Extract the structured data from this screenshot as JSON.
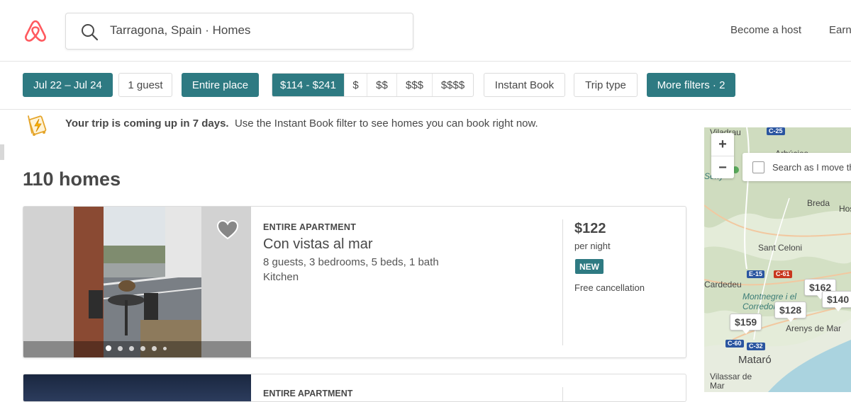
{
  "header": {
    "search_value": "Tarragona, Spain · Homes",
    "nav": {
      "become_host": "Become a host",
      "earn": "Earn"
    }
  },
  "filters": {
    "dates": "Jul 22 – Jul 24",
    "guests": "1 guest",
    "room_type": "Entire place",
    "price_range": "$114 - $241",
    "price_levels": [
      "$",
      "$$",
      "$$$",
      "$$$$"
    ],
    "instant_book": "Instant Book",
    "trip_type": "Trip type",
    "more_filters": "More filters · 2"
  },
  "banner": {
    "bold": "Your trip is coming up in 7 days.",
    "text": "Use the Instant Book filter to see homes you can book right now."
  },
  "results": {
    "count_label": "110 homes"
  },
  "listings": [
    {
      "type": "ENTIRE APARTMENT",
      "title": "Con vistas al mar",
      "details": "8 guests, 3 bedrooms, 5 beds, 1 bath",
      "amenities": "Kitchen",
      "price": "$122",
      "per_night": "per night",
      "badge": "NEW",
      "cancellation": "Free cancellation",
      "photo_count": 6,
      "active_photo": 1
    },
    {
      "type": "ENTIRE APARTMENT"
    }
  ],
  "map": {
    "zoom_in": "+",
    "zoom_out": "−",
    "search_move_label": "Search as I move the map",
    "pins": [
      "$159",
      "$128",
      "$162",
      "$140"
    ],
    "places": [
      "Viladrau",
      "Arbúcies",
      "Breda",
      "Hostalric",
      "Sant Celoni",
      "Montnegre i el Corredor",
      "Arenys de Mar",
      "Mataró",
      "Vilassar de Mar",
      "Cardedeu",
      "Seny"
    ],
    "roads": [
      "C-25",
      "E-15",
      "C-61",
      "C-60",
      "C-32"
    ]
  },
  "colors": {
    "accent": "#2e7a82",
    "brand": "#ff5a5f",
    "text": "#484848"
  }
}
